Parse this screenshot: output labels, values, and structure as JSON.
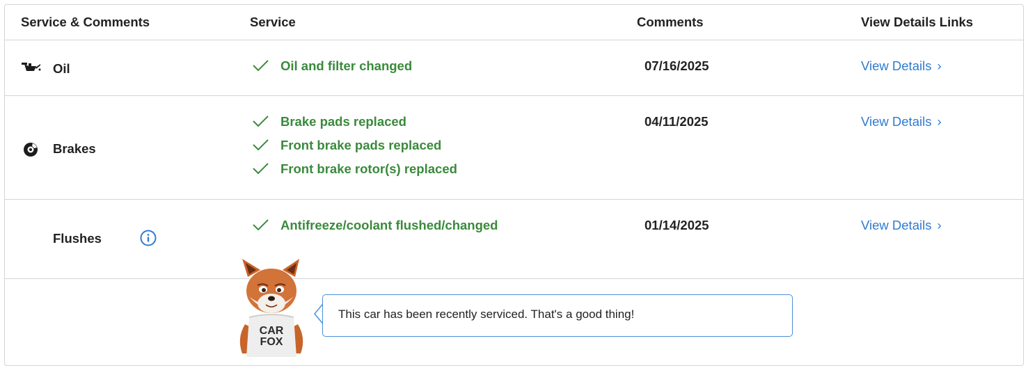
{
  "table": {
    "headers": {
      "service_comments": "Service & Comments",
      "service": "Service",
      "comments": "Comments",
      "view_details": "View Details Links"
    },
    "rows": [
      {
        "name": "Oil",
        "icon": "oil-can-icon",
        "items": [
          "Oil and filter changed"
        ],
        "date": "07/16/2025",
        "link": "View Details",
        "link_chevron": "›"
      },
      {
        "name": "Brakes",
        "icon": "brake-disc-icon",
        "items": [
          "Brake pads replaced",
          "Front brake pads replaced",
          "Front brake rotor(s) replaced"
        ],
        "date": "04/11/2025",
        "link": "View Details",
        "link_chevron": "›"
      },
      {
        "name": "Flushes",
        "icon": "info-icon",
        "items": [
          "Antifreeze/coolant flushed/changed"
        ],
        "date": "01/14/2025",
        "link": "View Details",
        "link_chevron": "›"
      }
    ]
  },
  "mascot": {
    "shirt_line1": "CAR",
    "shirt_line2": "FOX",
    "message": "This car has been recently serviced. That's a good thing!"
  },
  "colors": {
    "success_green": "#3a8a3c",
    "link_blue": "#2f7bd0",
    "border": "#d4d4d4"
  }
}
